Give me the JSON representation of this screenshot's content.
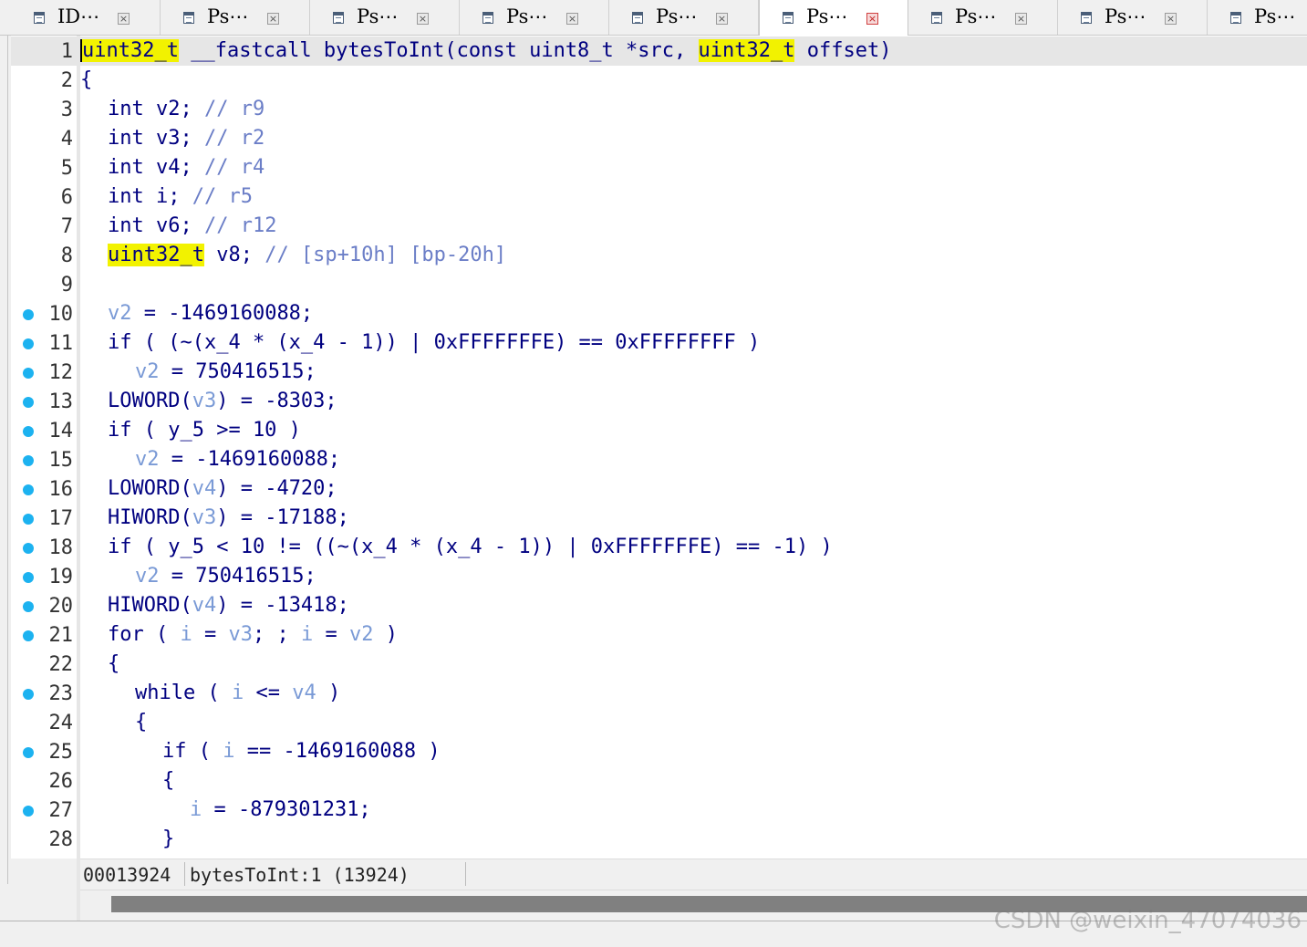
{
  "tabs": [
    {
      "label": "ID⋯",
      "close": "×",
      "active": false
    },
    {
      "label": "Ps⋯",
      "close": "×",
      "active": false
    },
    {
      "label": "Ps⋯",
      "close": "×",
      "active": false
    },
    {
      "label": "Ps⋯",
      "close": "×",
      "active": false
    },
    {
      "label": "Ps⋯",
      "close": "×",
      "active": false
    },
    {
      "label": "Ps⋯",
      "close": "×",
      "active": true
    },
    {
      "label": "Ps⋯",
      "close": "×",
      "active": false
    },
    {
      "label": "Ps⋯",
      "close": "×",
      "active": false
    },
    {
      "label": "Ps⋯",
      "close": "×",
      "active": false
    }
  ],
  "tab_icon": "pseudocode-view-icon",
  "colors": {
    "keyword": "#000080",
    "variable": "#7a9ad6",
    "comment": "#6b7ec7",
    "highlight": "#f2f200",
    "breakpoint_dot": "#1cb2f0",
    "current_line": "#e6e6e6",
    "active_close": "#c02020"
  },
  "code_lines": [
    {
      "n": "1",
      "dot": false,
      "current": true,
      "indent": 0,
      "tokens": [
        [
          "hl caret",
          "uint32_t"
        ],
        [
          "kw",
          " __fastcall bytesToInt(const uint8_t *src, "
        ],
        [
          "hl",
          "uint32_t"
        ],
        [
          "kw",
          " offset)"
        ]
      ]
    },
    {
      "n": "2",
      "dot": false,
      "indent": 0,
      "tokens": [
        [
          "kw",
          "{"
        ]
      ]
    },
    {
      "n": "3",
      "dot": false,
      "indent": 1,
      "tokens": [
        [
          "kw",
          "int v2; "
        ],
        [
          "cmt",
          "// r9"
        ]
      ]
    },
    {
      "n": "4",
      "dot": false,
      "indent": 1,
      "tokens": [
        [
          "kw",
          "int v3; "
        ],
        [
          "cmt",
          "// r2"
        ]
      ]
    },
    {
      "n": "5",
      "dot": false,
      "indent": 1,
      "tokens": [
        [
          "kw",
          "int v4; "
        ],
        [
          "cmt",
          "// r4"
        ]
      ]
    },
    {
      "n": "6",
      "dot": false,
      "indent": 1,
      "tokens": [
        [
          "kw",
          "int i; "
        ],
        [
          "cmt",
          "// r5"
        ]
      ]
    },
    {
      "n": "7",
      "dot": false,
      "indent": 1,
      "tokens": [
        [
          "kw",
          "int v6; "
        ],
        [
          "cmt",
          "// r12"
        ]
      ]
    },
    {
      "n": "8",
      "dot": false,
      "indent": 1,
      "tokens": [
        [
          "hl",
          "uint32_t"
        ],
        [
          "kw",
          " v8; "
        ],
        [
          "cmt",
          "// [sp+10h] [bp-20h]"
        ]
      ]
    },
    {
      "n": "9",
      "dot": false,
      "indent": 0,
      "tokens": []
    },
    {
      "n": "10",
      "dot": true,
      "indent": 1,
      "tokens": [
        [
          "var",
          "v2"
        ],
        [
          "kw",
          " = -1469160088;"
        ]
      ]
    },
    {
      "n": "11",
      "dot": true,
      "indent": 1,
      "tokens": [
        [
          "kw",
          "if ( (~(x_4 * (x_4 - 1)) | 0xFFFFFFFE) == 0xFFFFFFFF )"
        ]
      ]
    },
    {
      "n": "12",
      "dot": true,
      "indent": 2,
      "tokens": [
        [
          "var",
          "v2"
        ],
        [
          "kw",
          " = 750416515;"
        ]
      ]
    },
    {
      "n": "13",
      "dot": true,
      "indent": 1,
      "tokens": [
        [
          "kw",
          "LOWORD("
        ],
        [
          "var",
          "v3"
        ],
        [
          "kw",
          ") = -8303;"
        ]
      ]
    },
    {
      "n": "14",
      "dot": true,
      "indent": 1,
      "tokens": [
        [
          "kw",
          "if ( y_5 >= 10 )"
        ]
      ]
    },
    {
      "n": "15",
      "dot": true,
      "indent": 2,
      "tokens": [
        [
          "var",
          "v2"
        ],
        [
          "kw",
          " = -1469160088;"
        ]
      ]
    },
    {
      "n": "16",
      "dot": true,
      "indent": 1,
      "tokens": [
        [
          "kw",
          "LOWORD("
        ],
        [
          "var",
          "v4"
        ],
        [
          "kw",
          ") = -4720;"
        ]
      ]
    },
    {
      "n": "17",
      "dot": true,
      "indent": 1,
      "tokens": [
        [
          "kw",
          "HIWORD("
        ],
        [
          "var",
          "v3"
        ],
        [
          "kw",
          ") = -17188;"
        ]
      ]
    },
    {
      "n": "18",
      "dot": true,
      "indent": 1,
      "tokens": [
        [
          "kw",
          "if ( y_5 < 10 != ((~(x_4 * (x_4 - 1)) | 0xFFFFFFFE) == -1) )"
        ]
      ]
    },
    {
      "n": "19",
      "dot": true,
      "indent": 2,
      "tokens": [
        [
          "var",
          "v2"
        ],
        [
          "kw",
          " = 750416515;"
        ]
      ]
    },
    {
      "n": "20",
      "dot": true,
      "indent": 1,
      "tokens": [
        [
          "kw",
          "HIWORD("
        ],
        [
          "var",
          "v4"
        ],
        [
          "kw",
          ") = -13418;"
        ]
      ]
    },
    {
      "n": "21",
      "dot": true,
      "indent": 1,
      "tokens": [
        [
          "kw",
          "for ( "
        ],
        [
          "var",
          "i"
        ],
        [
          "kw",
          " = "
        ],
        [
          "var",
          "v3"
        ],
        [
          "kw",
          "; ; "
        ],
        [
          "var",
          "i"
        ],
        [
          "kw",
          " = "
        ],
        [
          "var",
          "v2"
        ],
        [
          "kw",
          " )"
        ]
      ]
    },
    {
      "n": "22",
      "dot": false,
      "indent": 1,
      "tokens": [
        [
          "kw",
          "{"
        ]
      ]
    },
    {
      "n": "23",
      "dot": true,
      "indent": 2,
      "tokens": [
        [
          "kw",
          "while ( "
        ],
        [
          "var",
          "i"
        ],
        [
          "kw",
          " <= "
        ],
        [
          "var",
          "v4"
        ],
        [
          "kw",
          " )"
        ]
      ]
    },
    {
      "n": "24",
      "dot": false,
      "indent": 2,
      "tokens": [
        [
          "kw",
          "{"
        ]
      ]
    },
    {
      "n": "25",
      "dot": true,
      "indent": 3,
      "tokens": [
        [
          "kw",
          "if ( "
        ],
        [
          "var",
          "i"
        ],
        [
          "kw",
          " == -1469160088 )"
        ]
      ]
    },
    {
      "n": "26",
      "dot": false,
      "indent": 3,
      "tokens": [
        [
          "kw",
          "{"
        ]
      ]
    },
    {
      "n": "27",
      "dot": true,
      "indent": 4,
      "tokens": [
        [
          "var",
          "i"
        ],
        [
          "kw",
          " = -879301231;"
        ]
      ]
    },
    {
      "n": "28",
      "dot": false,
      "indent": 3,
      "tokens": [
        [
          "kw",
          "}"
        ]
      ]
    }
  ],
  "status": {
    "address": "00013924",
    "location": "bytesToInt:1 (13924)"
  },
  "watermark": "CSDN @weixin_47074036"
}
